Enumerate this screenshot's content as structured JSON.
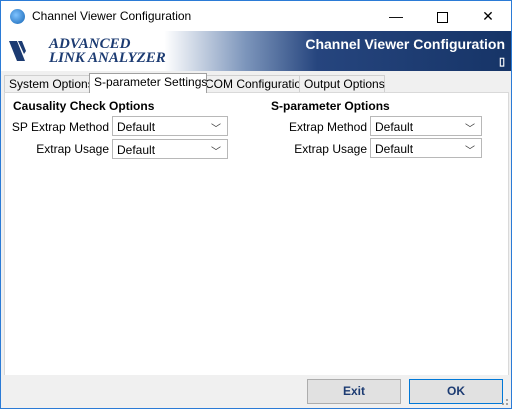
{
  "window": {
    "title": "Channel Viewer Configuration",
    "minimize": "—",
    "close": "✕"
  },
  "banner": {
    "logo_line1": "ADVANCED",
    "logo_line2": "LINK ANALYZER",
    "title": "Channel Viewer Configuration",
    "mark": "▯"
  },
  "tabs": [
    {
      "label": "System Options"
    },
    {
      "label": "S-parameter Settings",
      "active": true
    },
    {
      "label": "COM Configuration"
    },
    {
      "label": "Output Options"
    }
  ],
  "causality": {
    "heading": "Causality Check Options",
    "sp_extrap_method_label": "SP Extrap Method",
    "sp_extrap_method_value": "Default",
    "extrap_usage_label": "Extrap Usage",
    "extrap_usage_value": "Default"
  },
  "sparam": {
    "heading": "S-parameter Options",
    "extrap_method_label": "Extrap Method",
    "extrap_method_value": "Default",
    "extrap_usage_label": "Extrap Usage",
    "extrap_usage_value": "Default"
  },
  "footer": {
    "exit_label": "Exit",
    "ok_label": "OK"
  },
  "colors": {
    "accent": "#0078d7",
    "banner_dark": "#163467",
    "logo_blue": "#1c3b72"
  }
}
